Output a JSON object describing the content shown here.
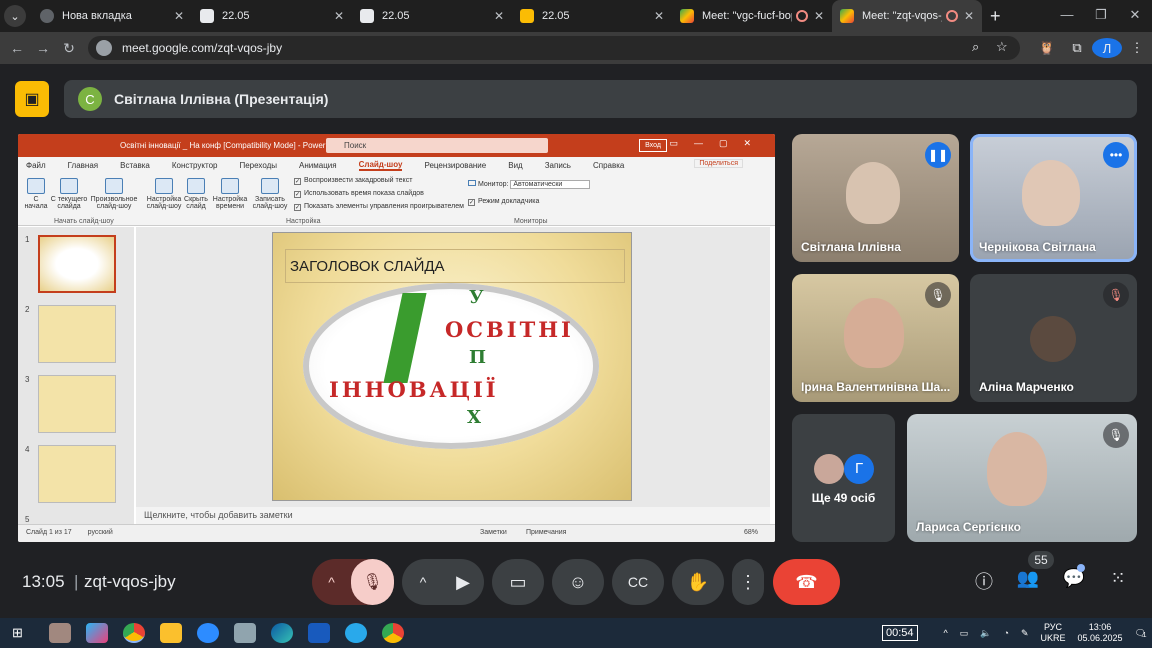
{
  "browser": {
    "tabs": [
      {
        "title": "Нова вкладка",
        "active": false
      },
      {
        "title": "22.05",
        "active": false
      },
      {
        "title": "22.05",
        "active": false
      },
      {
        "title": "22.05",
        "active": false
      },
      {
        "title": "Meet: \"vgc-fucf-bop\"",
        "active": false
      },
      {
        "title": "Meet: \"zqt-vqos-jby\"",
        "active": true
      }
    ],
    "url": "meet.google.com/zqt-vqos-jby",
    "profile_initial": "Л"
  },
  "presentation_banner": {
    "avatar_letter": "С",
    "title": "Світлана Іллівна (Презентація)"
  },
  "powerpoint": {
    "window_title": "Освітні інновації _ На конф [Compatibility Mode] - PowerPoint",
    "search_placeholder": "Поиск",
    "login": "Вход",
    "ribbon_tabs": [
      "Файл",
      "Главная",
      "Вставка",
      "Конструктор",
      "Переходы",
      "Анимация",
      "Слайд-шоу",
      "Рецензирование",
      "Вид",
      "Запись",
      "Справка"
    ],
    "active_tab": "Слайд-шоу",
    "share": "Поделиться",
    "buttons": [
      "С начала",
      "С текущего слайда",
      "Произвольное слайд-шоу",
      "Настройка слайд-шоу",
      "Скрыть слайд",
      "Настройка времени",
      "Записать слайд-шоу"
    ],
    "checks": [
      "Воспроизвести закадровый текст",
      "Использовать время показа слайдов",
      "Показать элементы управления проигрывателем"
    ],
    "monitor_label": "Монитор:",
    "monitor_value": "Автоматически",
    "presenter_mode": "Режим докладчика",
    "group_labels": [
      "Начать слайд-шоу",
      "Настройка",
      "Мониторы"
    ],
    "slide_numbers": [
      "1",
      "2",
      "3",
      "4",
      "5"
    ],
    "slide_title": "ЗАГОЛОВОК СЛАЙДА",
    "slide_words": {
      "top": "У",
      "line1": "ОСВІТНІ",
      "p": "П",
      "line2": "ІННОВАЦІЇ",
      "x": "Х"
    },
    "notes_placeholder": "Щелкните, чтобы добавить заметки",
    "status_left": "Слайд 1 из 17",
    "status_lang": "русский",
    "status_notes": "Заметки",
    "status_comments": "Примечания",
    "zoom": "68%"
  },
  "participants": [
    {
      "name": "Світлана Іллівна",
      "state": "speaking"
    },
    {
      "name": "Чернікова Світлана",
      "state": "more"
    },
    {
      "name": "Ірина Валентинівна Ша...",
      "state": "muted"
    },
    {
      "name": "Аліна Марченко",
      "state": "muted"
    },
    {
      "name": "Ще 49 осіб",
      "state": "group"
    },
    {
      "name": "Лариса Сергієнко",
      "state": "muted"
    }
  ],
  "more_avatar_letter": "Г",
  "meeting": {
    "time": "13:05",
    "code": "zqt-vqos-jby",
    "participant_count": "55"
  },
  "taskbar": {
    "timer": "00:54",
    "lang": "РУС",
    "lang2": "UKRE",
    "time": "13:06",
    "date": "05.06.2025",
    "notif": "1"
  },
  "colors": {
    "end_call": "#ea4335",
    "mute_active": "#f6cdc9",
    "accent": "#8ab4f8"
  }
}
